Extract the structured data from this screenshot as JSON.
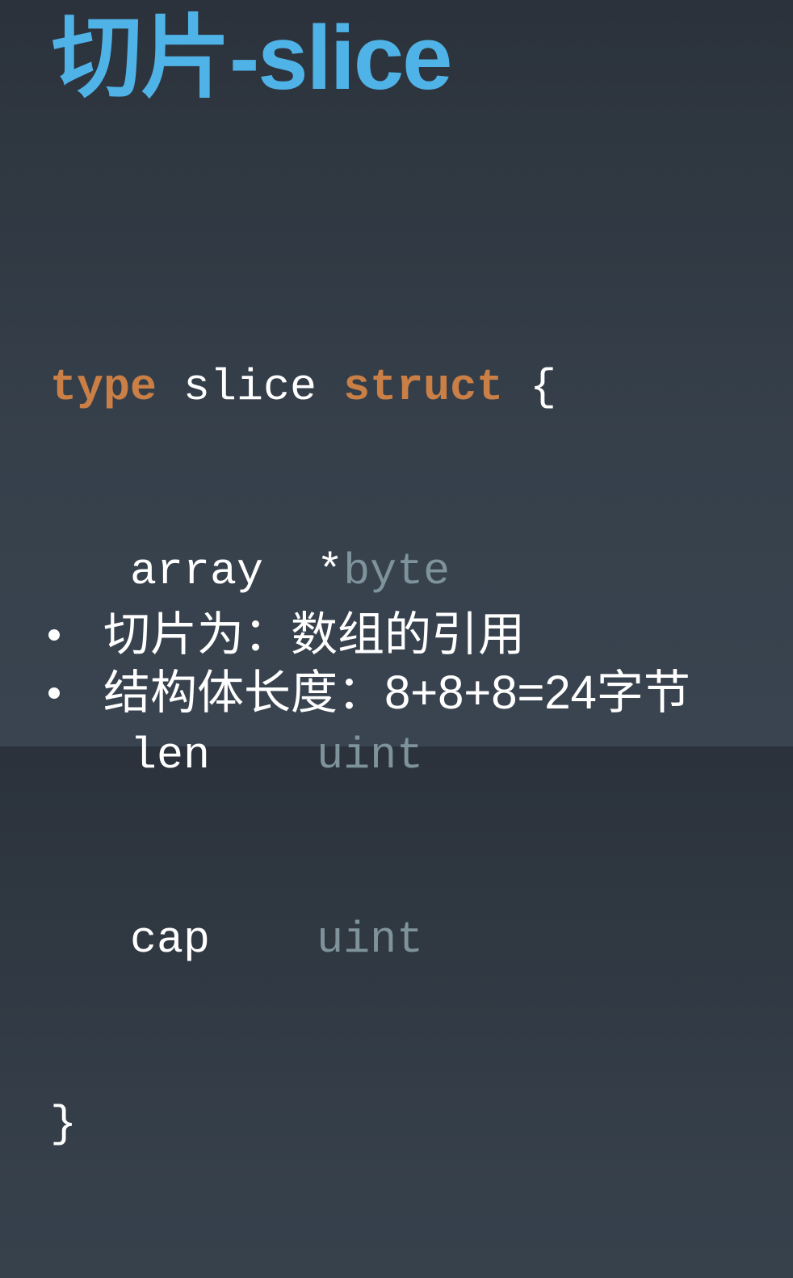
{
  "slide": {
    "title": "切片-slice",
    "code": {
      "line1": {
        "kw_type": "type",
        "name": " slice ",
        "kw_struct": "struct",
        "brace": " {"
      },
      "fields": [
        {
          "indent": "   ",
          "name": "array",
          "gap": "  ",
          "star": "*",
          "type": "byte"
        },
        {
          "indent": "   ",
          "name": "len",
          "gap": "    ",
          "star": "",
          "type": "uint"
        },
        {
          "indent": "   ",
          "name": "cap",
          "gap": "    ",
          "star": "",
          "type": "uint"
        }
      ],
      "closing": "}"
    },
    "bullets": [
      "切片为：数组的引用",
      "结构体长度：8+8+8=24字节"
    ],
    "colors": {
      "title": "#4fb3e8",
      "keyword": "#c97f45",
      "type": "#7e939b",
      "text": "#ffffff",
      "background": "#2f3742"
    }
  }
}
